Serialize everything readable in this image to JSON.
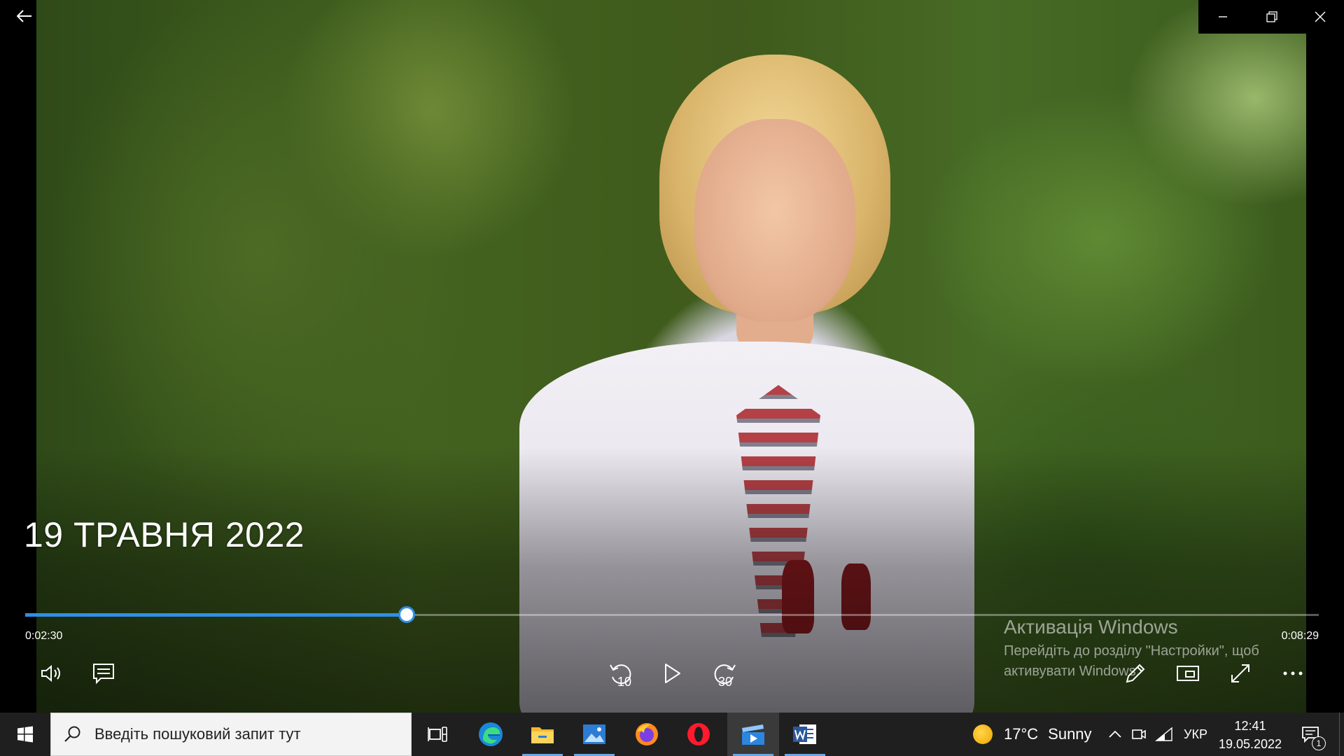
{
  "video": {
    "title": "19 ТРАВНЯ 2022",
    "time_elapsed": "0:02:30",
    "time_total": "0:08:29",
    "progress_fraction": 0.295,
    "skip_back_seconds": "10",
    "skip_forward_seconds": "30"
  },
  "watermark": {
    "title": "Активація Windows",
    "text": "Перейдіть до розділу \"Настройки\", щоб активувати Windows."
  },
  "taskbar": {
    "search_placeholder": "Введіть пошуковий запит тут",
    "weather_temp": "17°C",
    "weather_condition": "Sunny",
    "language": "УКР",
    "time": "12:41",
    "date": "19.05.2022",
    "notification_count": "1"
  },
  "colors": {
    "seek_accent": "#2f8fe6",
    "taskbar_bg": "#1f1f1f"
  }
}
